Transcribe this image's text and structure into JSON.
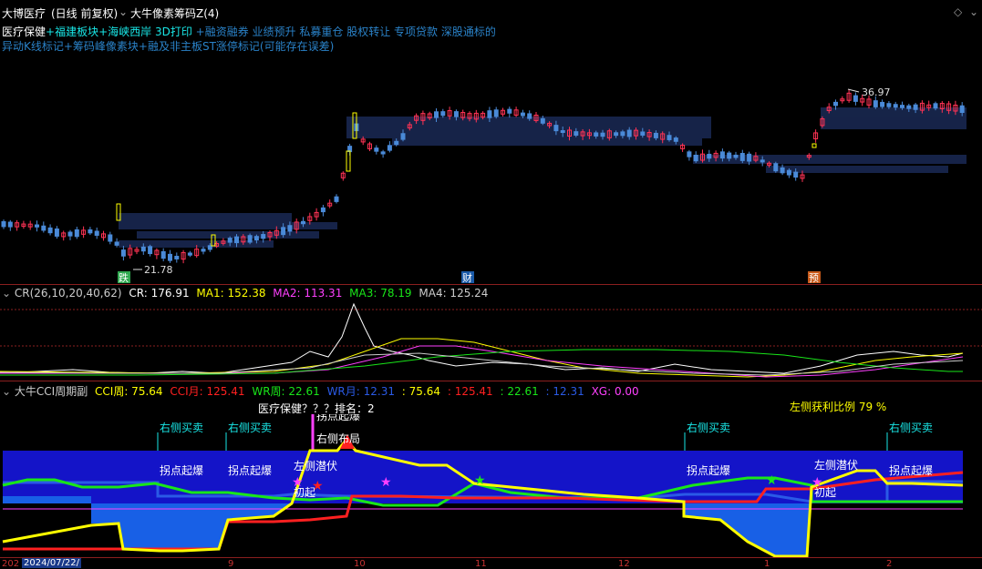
{
  "window": {
    "stock_title": "大博医疗",
    "period_label": "(日线 前复权)",
    "indicator_title": "大牛像素筹码Z(4)"
  },
  "concepts": {
    "line1": [
      {
        "text": "医疗保健",
        "color": "#ffffff"
      },
      {
        "text": "+福建板块",
        "color": "#19e6e6"
      },
      {
        "text": "+海峡西岸",
        "color": "#19e6e6"
      },
      {
        "text": " 3D打印",
        "color": "#19e6e6"
      },
      {
        "text": " +融资融券",
        "color": "#2a82c8"
      },
      {
        "text": " 业绩预升",
        "color": "#2a82c8"
      },
      {
        "text": " 私募重仓",
        "color": "#2a82c8"
      },
      {
        "text": " 股权转让",
        "color": "#2a82c8"
      },
      {
        "text": " 专项贷款",
        "color": "#2a82c8"
      },
      {
        "text": " 深股通标的",
        "color": "#2a82c8"
      }
    ],
    "line2": "异动K线标记+筹码峰像素块+融及非主板ST涨停标记(可能存在误差)"
  },
  "price_panel": {
    "low_marker": "21.78",
    "high_marker": "36.97",
    "event_tags": [
      {
        "text": "跌",
        "color": "#2fa84f"
      },
      {
        "text": "财",
        "color": "#1a5aa8"
      },
      {
        "text": "预",
        "color": "#c85a1a"
      }
    ]
  },
  "cr_panel": {
    "name": "CR(26,10,20,40,62)",
    "items": [
      {
        "label": "CR: 176.91",
        "color": "#ffffff"
      },
      {
        "label": "MA1: 152.38",
        "color": "#ffff00"
      },
      {
        "label": "MA2: 113.31",
        "color": "#ff40ff"
      },
      {
        "label": "MA3: 78.19",
        "color": "#19e619"
      },
      {
        "label": "MA4: 125.24",
        "color": "#cccccc"
      }
    ]
  },
  "cci_panel": {
    "name": "大牛CCI周期副",
    "items": [
      {
        "label": "CCI周: 75.64",
        "color": "#ffff00"
      },
      {
        "label": "CCI月: 125.41",
        "color": "#ff2020"
      },
      {
        "label": "WR周: 22.61",
        "color": "#19e619"
      },
      {
        "label": "WR月: 12.31",
        "color": "#2a5ae6"
      },
      {
        "label": ": 75.64",
        "color": "#ffff00"
      },
      {
        "label": ": 125.41",
        "color": "#ff2020"
      },
      {
        "label": ": 22.61",
        "color": "#19e619"
      },
      {
        "label": ": 12.31",
        "color": "#2a5ae6"
      },
      {
        "label": "XG: 0.00",
        "color": "#ff40ff"
      }
    ],
    "rank_text": "医疗保健？？？排名：2",
    "ratio_text": "左侧获利比例 79 %",
    "annotations": {
      "right_buy": "右侧买卖",
      "breakout": "拐点起爆",
      "left_lurk": "左侧潜伏",
      "right_pattern": "右侧布局",
      "initial": "初起"
    }
  },
  "x_axis": {
    "labels": [
      "202",
      "2024/07/22/",
      "9",
      "10",
      "11",
      "12",
      "1",
      "2"
    ]
  }
}
